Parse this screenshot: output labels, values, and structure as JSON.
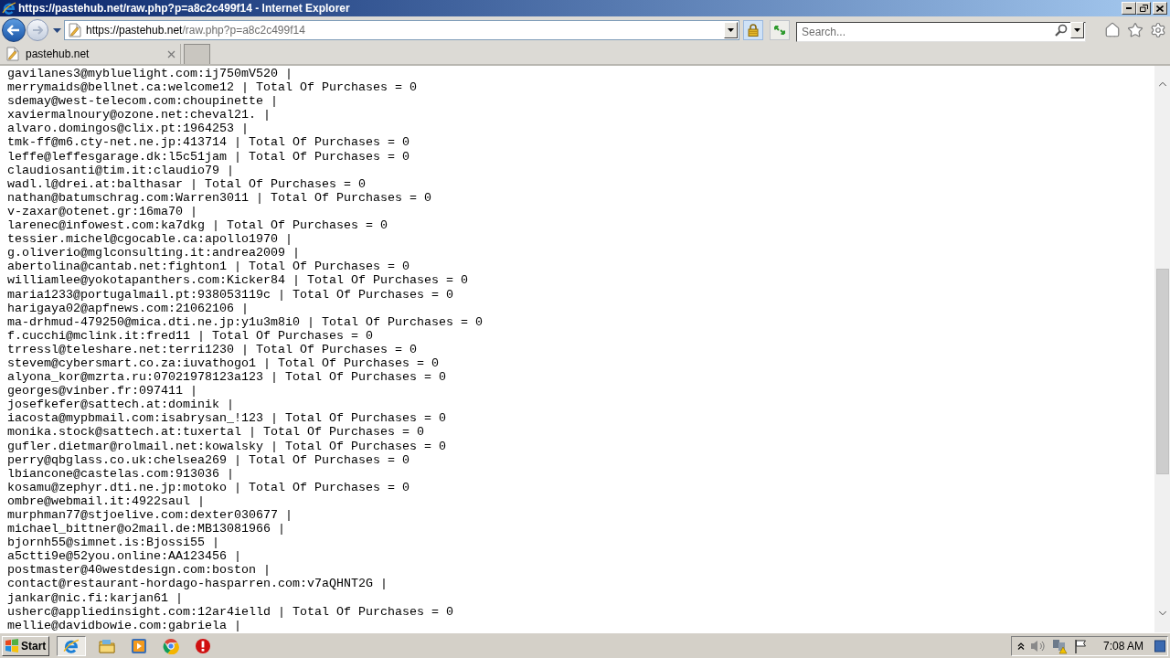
{
  "window": {
    "title": "https://pastehub.net/raw.php?p=a8c2c499f14 - Internet Explorer"
  },
  "address_bar": {
    "host": "https://pastehub.net",
    "path": "/raw.php?p=a8c2c499f14"
  },
  "search": {
    "placeholder": "Search..."
  },
  "tabs": [
    {
      "label": "pastehub.net",
      "selected": true
    }
  ],
  "content": {
    "lines": [
      "gavilanes3@mybluelight.com:ij750mV520 |",
      "merrymaids@bellnet.ca:welcome12 | Total Of Purchases = 0",
      "sdemay@west-telecom.com:choupinette |",
      "xaviermalnoury@ozone.net:cheval21. |",
      "alvaro.domingos@clix.pt:1964253 |",
      "tmk-ff@m6.cty-net.ne.jp:413714 | Total Of Purchases = 0",
      "leffe@leffesgarage.dk:l5c51jam | Total Of Purchases = 0",
      "claudiosanti@tim.it:claudio79 |",
      "wadl.l@drei.at:balthasar | Total Of Purchases = 0",
      "nathan@batumschrag.com:Warren3011 | Total Of Purchases = 0",
      "v-zaxar@otenet.gr:16ma70 |",
      "larenec@infowest.com:ka7dkg | Total Of Purchases = 0",
      "tessier.michel@cgocable.ca:apollo1970 |",
      "g.oliverio@mglconsulting.it:andrea2009 |",
      "abertolina@cantab.net:fighton1 | Total Of Purchases = 0",
      "williamlee@yokotapanthers.com:Kicker84 | Total Of Purchases = 0",
      "maria1233@portugalmail.pt:938053119c | Total Of Purchases = 0",
      "harigaya02@apfnews.com:21062106 |",
      "ma-drhmud-479250@mica.dti.ne.jp:y1u3m8i0 | Total Of Purchases = 0",
      "f.cucchi@mclink.it:fred11 | Total Of Purchases = 0",
      "trressl@teleshare.net:terri1230 | Total Of Purchases = 0",
      "stevem@cybersmart.co.za:iuvathogo1 | Total Of Purchases = 0",
      "alyona_kor@mzrta.ru:07021978123a123 | Total Of Purchases = 0",
      "georges@vinber.fr:097411 |",
      "josefkefer@sattech.at:dominik |",
      "iacosta@mypbmail.com:isabrysan_!123 | Total Of Purchases = 0",
      "monika.stock@sattech.at:tuxertal | Total Of Purchases = 0",
      "gufler.dietmar@rolmail.net:kowalsky | Total Of Purchases = 0",
      "perry@qbglass.co.uk:chelsea269 | Total Of Purchases = 0",
      "lbiancone@castelas.com:913036 |",
      "kosamu@zephyr.dti.ne.jp:motoko | Total Of Purchases = 0",
      "ombre@webmail.it:4922saul |",
      "murphman77@stjoelive.com:dexter030677 |",
      "michael_bittner@o2mail.de:MB13081966 |",
      "bjornh55@simnet.is:Bjossi55 |",
      "a5ctti9e@52you.online:AA123456 |",
      "postmaster@40westdesign.com:boston |",
      "contact@restaurant-hordago-hasparren.com:v7aQHNT2G |",
      "jankar@nic.fi:karjan61 |",
      "usherc@appliedinsight.com:12ar4ielld | Total Of Purchases = 0",
      "mellie@davidbowie.com:gabriela |"
    ]
  },
  "taskbar": {
    "start": "Start",
    "apps": [
      {
        "kind": "ie",
        "selected": true
      },
      {
        "kind": "folder",
        "selected": false
      },
      {
        "kind": "media",
        "selected": false
      },
      {
        "kind": "chrome",
        "selected": false
      },
      {
        "kind": "stop",
        "selected": false
      }
    ],
    "clock": "7:08 AM"
  }
}
